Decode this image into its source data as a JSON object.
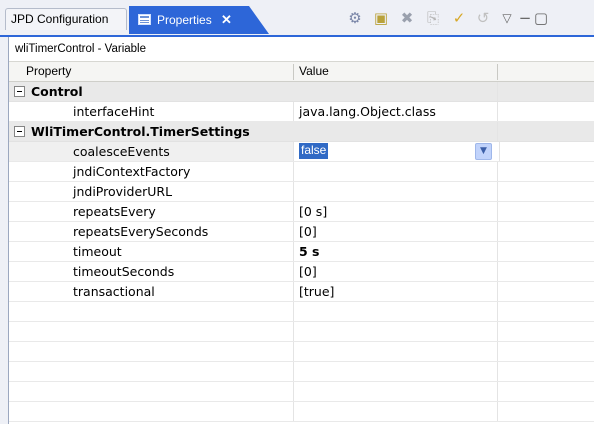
{
  "tabs": {
    "inactive_label": "JPD Configuration",
    "active_label": "Properties",
    "close_glyph": "✕"
  },
  "toolbar": {
    "icons": [
      "show-categories-icon",
      "new-element-icon",
      "delete-icon",
      "export-icon",
      "checkmark-icon",
      "undo-icon",
      "view-menu-icon",
      "minimize-icon",
      "maximize-icon"
    ],
    "glyphs": [
      "⚙",
      "▣",
      "✖",
      "⎘",
      "✓",
      "↺",
      "▽",
      "−",
      "▢"
    ]
  },
  "panel": {
    "title": "wliTimerControl - Variable",
    "columns": {
      "property": "Property",
      "value": "Value"
    }
  },
  "categories": [
    {
      "label": "Control"
    },
    {
      "label": "WliTimerControl.TimerSettings"
    }
  ],
  "rows": [
    {
      "property": "interfaceHint",
      "value": "java.lang.Object.class"
    },
    {
      "property": "coalesceEvents",
      "value": "false"
    },
    {
      "property": "jndiContextFactory",
      "value": ""
    },
    {
      "property": "jndiProviderURL",
      "value": ""
    },
    {
      "property": "repeatsEvery",
      "value": "[0 s]"
    },
    {
      "property": "repeatsEverySeconds",
      "value": "[0]"
    },
    {
      "property": "timeout",
      "value": "5 s"
    },
    {
      "property": "timeoutSeconds",
      "value": "[0]"
    },
    {
      "property": "transactional",
      "value": "[true]"
    }
  ],
  "colors": {
    "active_tab": "#2d66d8",
    "selection": "#316ac5",
    "category_bg": "#e9e9e9"
  }
}
